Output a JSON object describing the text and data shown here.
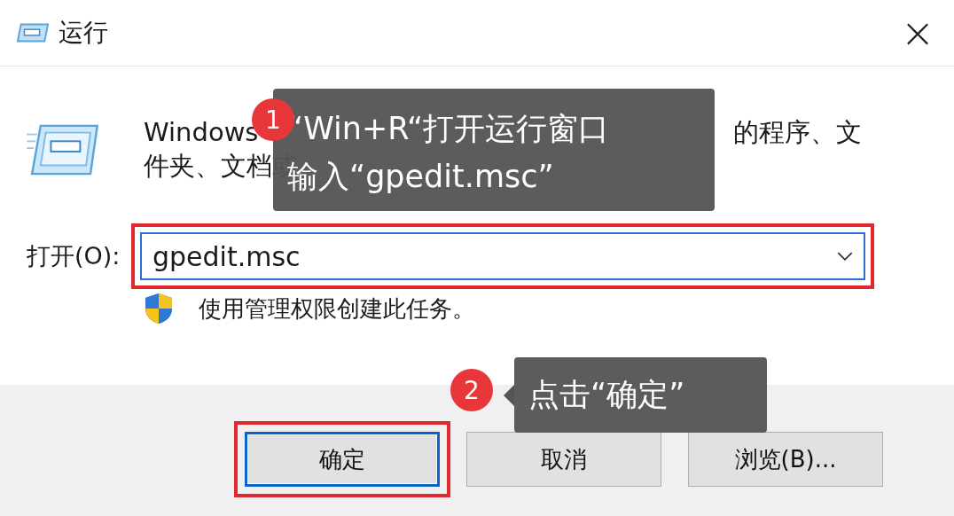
{
  "window": {
    "title": "运行",
    "close": "×"
  },
  "description": {
    "line_1_start": "Windows",
    "line_1_end": "的程序、文",
    "line_2": "件夹、文档或"
  },
  "open_field": {
    "label": "打开(O):",
    "value": "gpedit.msc",
    "highlighted": true
  },
  "admin_note": "使用管理权限创建此任务。",
  "buttons": [
    {
      "label": "确定",
      "default": true,
      "highlighted": true
    },
    {
      "label": "取消",
      "default": false,
      "highlighted": false
    },
    {
      "label": "浏览(B)...",
      "default": false,
      "highlighted": false
    }
  ],
  "annotations": [
    {
      "number": "1",
      "lines": [
        "“Win+R“打开运行窗口",
        "输入“gpedit.msc”"
      ]
    },
    {
      "number": "2",
      "lines": [
        "点击“确定”"
      ]
    }
  ]
}
